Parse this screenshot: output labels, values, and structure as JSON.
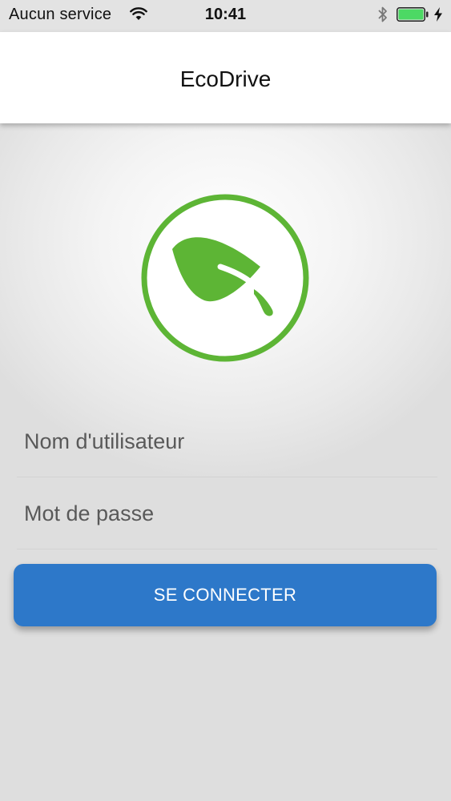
{
  "status_bar": {
    "carrier": "Aucun service",
    "time": "10:41",
    "battery_level_percent": 100,
    "icons": [
      "wifi-icon",
      "bluetooth-icon",
      "battery-icon",
      "charging-bolt-icon"
    ]
  },
  "nav": {
    "title": "EcoDrive"
  },
  "logo": {
    "icon": "leaf-icon",
    "color": "#5db535"
  },
  "form": {
    "username_placeholder": "Nom d'utilisateur",
    "username_value": "",
    "password_placeholder": "Mot de passe",
    "password_value": "",
    "submit_label": "SE CONNECTER"
  },
  "colors": {
    "accent_blue": "#2d78c9",
    "brand_green": "#5db535",
    "battery_green": "#4cd964"
  }
}
